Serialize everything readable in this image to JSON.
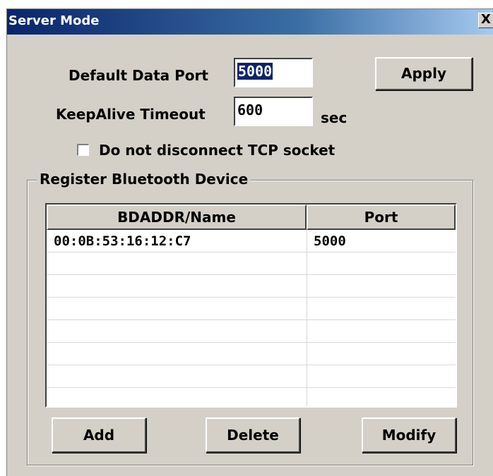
{
  "window": {
    "title": "Server Mode",
    "close_label": "X"
  },
  "form": {
    "default_data_port_label": "Default Data Port",
    "default_data_port_value": "5000",
    "keepalive_label": "KeepAlive Timeout",
    "keepalive_value": "600",
    "keepalive_unit": "sec",
    "apply_label": "Apply",
    "checkbox_label": "Do not disconnect TCP socket",
    "checkbox_checked": false
  },
  "group": {
    "title": "Register Bluetooth Device",
    "columns": [
      "BDADDR/Name",
      "Port"
    ],
    "rows": [
      {
        "name": "00:0B:53:16:12:C7",
        "port": "5000"
      }
    ],
    "add_label": "Add",
    "delete_label": "Delete",
    "modify_label": "Modify"
  }
}
